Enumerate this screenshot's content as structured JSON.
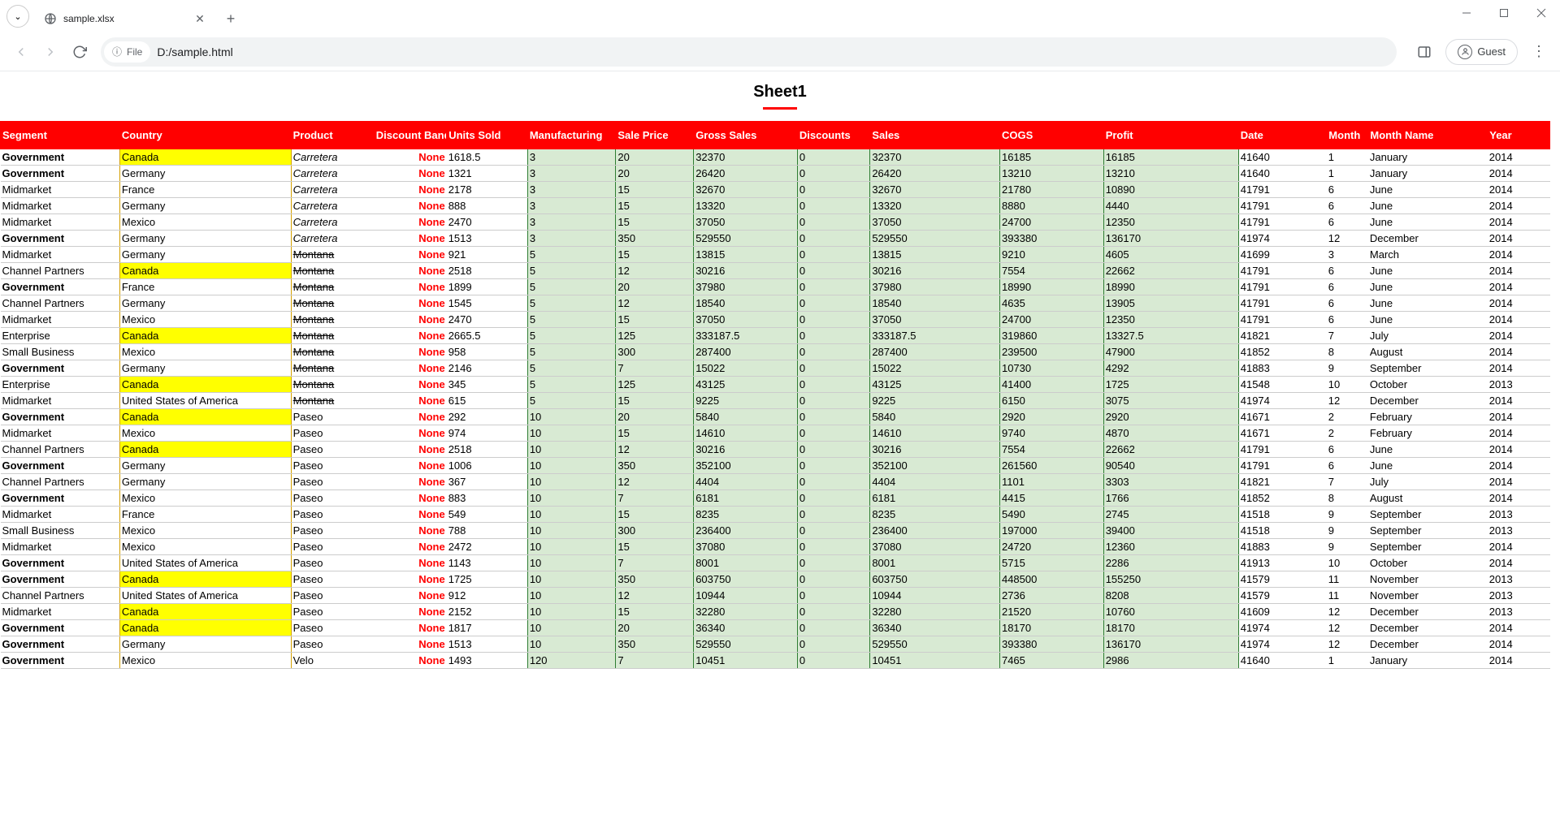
{
  "window": {
    "tab_title": "sample.xlsx",
    "file_chip_label": "File",
    "url": "D:/sample.html",
    "guest_label": "Guest"
  },
  "sheet_title": "Sheet1",
  "legend": {
    "yellow_countries": [
      "Canada"
    ],
    "italic_products": [
      "Carretera"
    ],
    "strike_products": [
      "Montana"
    ],
    "bold_segments": [
      "Government"
    ]
  },
  "headers": [
    "Segment",
    "Country",
    "Product",
    "Discount Band",
    "Units Sold",
    "Manufacturing",
    "Sale Price",
    "Gross Sales",
    "Discounts",
    "Sales",
    "COGS",
    "Profit",
    "Date",
    "Month",
    "Month Name",
    "Year"
  ],
  "rows": [
    [
      "Government",
      "Canada",
      "Carretera",
      "None",
      "1618.5",
      "3",
      "20",
      "32370",
      "0",
      "32370",
      "16185",
      "16185",
      "41640",
      "1",
      "January",
      "2014"
    ],
    [
      "Government",
      "Germany",
      "Carretera",
      "None",
      "1321",
      "3",
      "20",
      "26420",
      "0",
      "26420",
      "13210",
      "13210",
      "41640",
      "1",
      "January",
      "2014"
    ],
    [
      "Midmarket",
      "France",
      "Carretera",
      "None",
      "2178",
      "3",
      "15",
      "32670",
      "0",
      "32670",
      "21780",
      "10890",
      "41791",
      "6",
      "June",
      "2014"
    ],
    [
      "Midmarket",
      "Germany",
      "Carretera",
      "None",
      "888",
      "3",
      "15",
      "13320",
      "0",
      "13320",
      "8880",
      "4440",
      "41791",
      "6",
      "June",
      "2014"
    ],
    [
      "Midmarket",
      "Mexico",
      "Carretera",
      "None",
      "2470",
      "3",
      "15",
      "37050",
      "0",
      "37050",
      "24700",
      "12350",
      "41791",
      "6",
      "June",
      "2014"
    ],
    [
      "Government",
      "Germany",
      "Carretera",
      "None",
      "1513",
      "3",
      "350",
      "529550",
      "0",
      "529550",
      "393380",
      "136170",
      "41974",
      "12",
      "December",
      "2014"
    ],
    [
      "Midmarket",
      "Germany",
      "Montana",
      "None",
      "921",
      "5",
      "15",
      "13815",
      "0",
      "13815",
      "9210",
      "4605",
      "41699",
      "3",
      "March",
      "2014"
    ],
    [
      "Channel Partners",
      "Canada",
      "Montana",
      "None",
      "2518",
      "5",
      "12",
      "30216",
      "0",
      "30216",
      "7554",
      "22662",
      "41791",
      "6",
      "June",
      "2014"
    ],
    [
      "Government",
      "France",
      "Montana",
      "None",
      "1899",
      "5",
      "20",
      "37980",
      "0",
      "37980",
      "18990",
      "18990",
      "41791",
      "6",
      "June",
      "2014"
    ],
    [
      "Channel Partners",
      "Germany",
      "Montana",
      "None",
      "1545",
      "5",
      "12",
      "18540",
      "0",
      "18540",
      "4635",
      "13905",
      "41791",
      "6",
      "June",
      "2014"
    ],
    [
      "Midmarket",
      "Mexico",
      "Montana",
      "None",
      "2470",
      "5",
      "15",
      "37050",
      "0",
      "37050",
      "24700",
      "12350",
      "41791",
      "6",
      "June",
      "2014"
    ],
    [
      "Enterprise",
      "Canada",
      "Montana",
      "None",
      "2665.5",
      "5",
      "125",
      "333187.5",
      "0",
      "333187.5",
      "319860",
      "13327.5",
      "41821",
      "7",
      "July",
      "2014"
    ],
    [
      "Small Business",
      "Mexico",
      "Montana",
      "None",
      "958",
      "5",
      "300",
      "287400",
      "0",
      "287400",
      "239500",
      "47900",
      "41852",
      "8",
      "August",
      "2014"
    ],
    [
      "Government",
      "Germany",
      "Montana",
      "None",
      "2146",
      "5",
      "7",
      "15022",
      "0",
      "15022",
      "10730",
      "4292",
      "41883",
      "9",
      "September",
      "2014"
    ],
    [
      "Enterprise",
      "Canada",
      "Montana",
      "None",
      "345",
      "5",
      "125",
      "43125",
      "0",
      "43125",
      "41400",
      "1725",
      "41548",
      "10",
      "October",
      "2013"
    ],
    [
      "Midmarket",
      "United States of America",
      "Montana",
      "None",
      "615",
      "5",
      "15",
      "9225",
      "0",
      "9225",
      "6150",
      "3075",
      "41974",
      "12",
      "December",
      "2014"
    ],
    [
      "Government",
      "Canada",
      "Paseo",
      "None",
      "292",
      "10",
      "20",
      "5840",
      "0",
      "5840",
      "2920",
      "2920",
      "41671",
      "2",
      "February",
      "2014"
    ],
    [
      "Midmarket",
      "Mexico",
      "Paseo",
      "None",
      "974",
      "10",
      "15",
      "14610",
      "0",
      "14610",
      "9740",
      "4870",
      "41671",
      "2",
      "February",
      "2014"
    ],
    [
      "Channel Partners",
      "Canada",
      "Paseo",
      "None",
      "2518",
      "10",
      "12",
      "30216",
      "0",
      "30216",
      "7554",
      "22662",
      "41791",
      "6",
      "June",
      "2014"
    ],
    [
      "Government",
      "Germany",
      "Paseo",
      "None",
      "1006",
      "10",
      "350",
      "352100",
      "0",
      "352100",
      "261560",
      "90540",
      "41791",
      "6",
      "June",
      "2014"
    ],
    [
      "Channel Partners",
      "Germany",
      "Paseo",
      "None",
      "367",
      "10",
      "12",
      "4404",
      "0",
      "4404",
      "1101",
      "3303",
      "41821",
      "7",
      "July",
      "2014"
    ],
    [
      "Government",
      "Mexico",
      "Paseo",
      "None",
      "883",
      "10",
      "7",
      "6181",
      "0",
      "6181",
      "4415",
      "1766",
      "41852",
      "8",
      "August",
      "2014"
    ],
    [
      "Midmarket",
      "France",
      "Paseo",
      "None",
      "549",
      "10",
      "15",
      "8235",
      "0",
      "8235",
      "5490",
      "2745",
      "41518",
      "9",
      "September",
      "2013"
    ],
    [
      "Small Business",
      "Mexico",
      "Paseo",
      "None",
      "788",
      "10",
      "300",
      "236400",
      "0",
      "236400",
      "197000",
      "39400",
      "41518",
      "9",
      "September",
      "2013"
    ],
    [
      "Midmarket",
      "Mexico",
      "Paseo",
      "None",
      "2472",
      "10",
      "15",
      "37080",
      "0",
      "37080",
      "24720",
      "12360",
      "41883",
      "9",
      "September",
      "2014"
    ],
    [
      "Government",
      "United States of America",
      "Paseo",
      "None",
      "1143",
      "10",
      "7",
      "8001",
      "0",
      "8001",
      "5715",
      "2286",
      "41913",
      "10",
      "October",
      "2014"
    ],
    [
      "Government",
      "Canada",
      "Paseo",
      "None",
      "1725",
      "10",
      "350",
      "603750",
      "0",
      "603750",
      "448500",
      "155250",
      "41579",
      "11",
      "November",
      "2013"
    ],
    [
      "Channel Partners",
      "United States of America",
      "Paseo",
      "None",
      "912",
      "10",
      "12",
      "10944",
      "0",
      "10944",
      "2736",
      "8208",
      "41579",
      "11",
      "November",
      "2013"
    ],
    [
      "Midmarket",
      "Canada",
      "Paseo",
      "None",
      "2152",
      "10",
      "15",
      "32280",
      "0",
      "32280",
      "21520",
      "10760",
      "41609",
      "12",
      "December",
      "2013"
    ],
    [
      "Government",
      "Canada",
      "Paseo",
      "None",
      "1817",
      "10",
      "20",
      "36340",
      "0",
      "36340",
      "18170",
      "18170",
      "41974",
      "12",
      "December",
      "2014"
    ],
    [
      "Government",
      "Germany",
      "Paseo",
      "None",
      "1513",
      "10",
      "350",
      "529550",
      "0",
      "529550",
      "393380",
      "136170",
      "41974",
      "12",
      "December",
      "2014"
    ],
    [
      "Government",
      "Mexico",
      "Velo",
      "None",
      "1493",
      "120",
      "7",
      "10451",
      "0",
      "10451",
      "7465",
      "2986",
      "41640",
      "1",
      "January",
      "2014"
    ]
  ]
}
